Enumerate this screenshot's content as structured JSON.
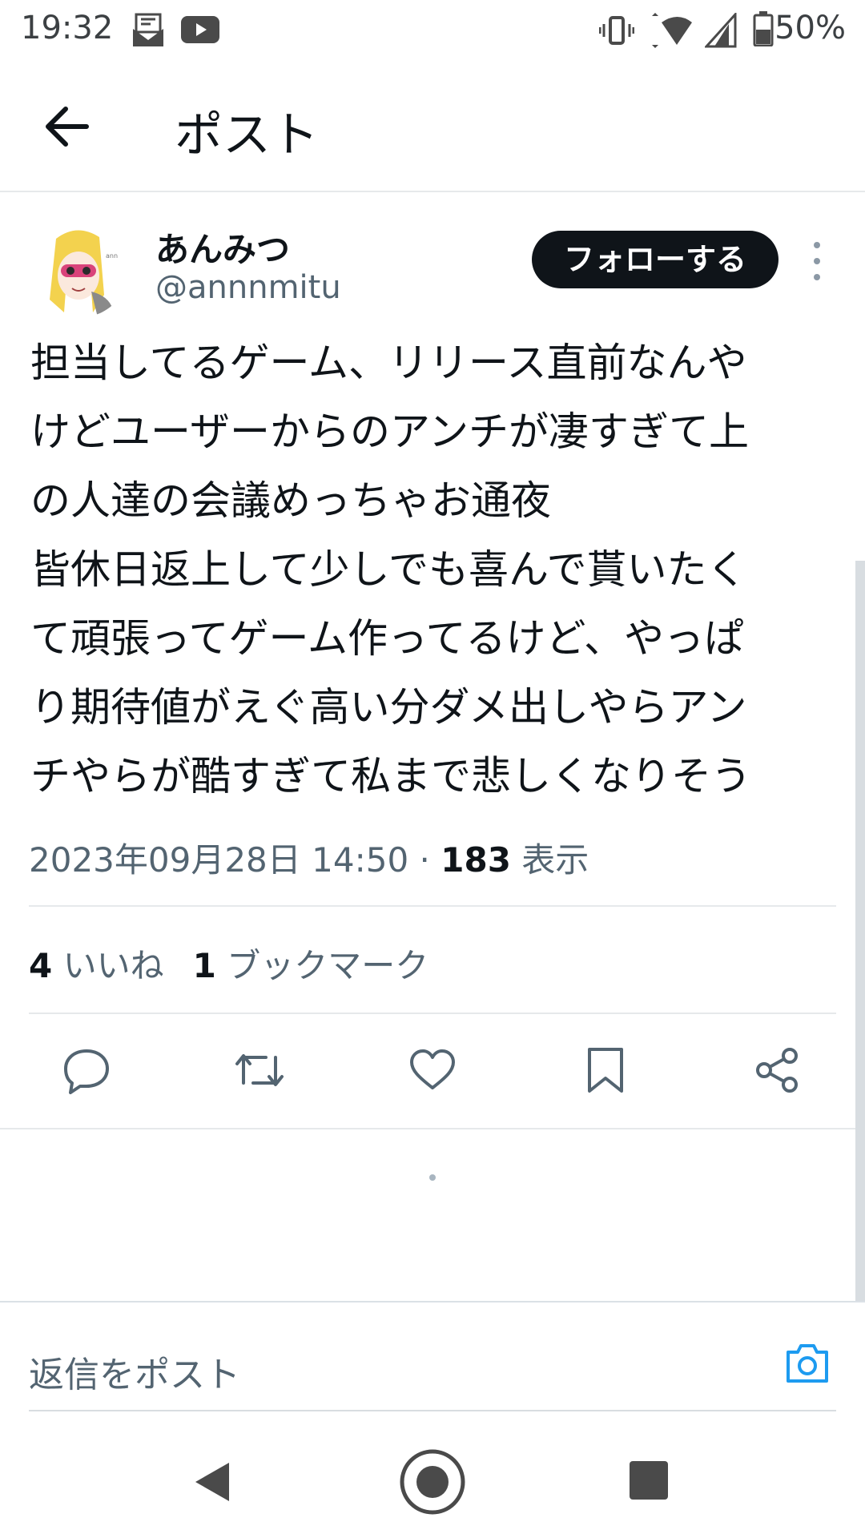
{
  "status_bar": {
    "time": "19:32",
    "battery": "50%",
    "icons": [
      "mail-icon",
      "youtube-icon",
      "vibrate-icon",
      "wifi-icon",
      "signal-icon",
      "battery-icon"
    ]
  },
  "header": {
    "title": "ポスト",
    "back_icon": "arrow-left-icon"
  },
  "author": {
    "display_name": "あんみつ",
    "handle": "@annnmitu",
    "follow_label": "フォローする"
  },
  "post": {
    "lines": [
      "担当してるゲーム、リリース直前なんや",
      "けどユーザーからのアンチが凄すぎて上",
      "の人達の会議めっちゃお通夜",
      "皆休日返上して少しでも喜んで貰いたく",
      "て頑張ってゲーム作ってるけど、やっぱ",
      "り期待値がえぐ高い分ダメ出しやらアン",
      "チやらが酷すぎて私まで悲しくなりそう"
    ],
    "timestamp": "2023年09月28日 14:50",
    "separator": "·",
    "views_count": "183",
    "views_label": "表示"
  },
  "stats": {
    "likes_count": "4",
    "likes_label": "いいね",
    "bookmarks_count": "1",
    "bookmarks_label": "ブックマーク"
  },
  "actions": [
    "reply-icon",
    "repost-icon",
    "like-icon",
    "bookmark-icon",
    "share-icon"
  ],
  "reply": {
    "placeholder": "返信をポスト"
  },
  "colors": {
    "text_primary": "#0f1419",
    "text_secondary": "#536471",
    "accent": "#1d9bf0",
    "follow_bg": "#0f1419"
  }
}
